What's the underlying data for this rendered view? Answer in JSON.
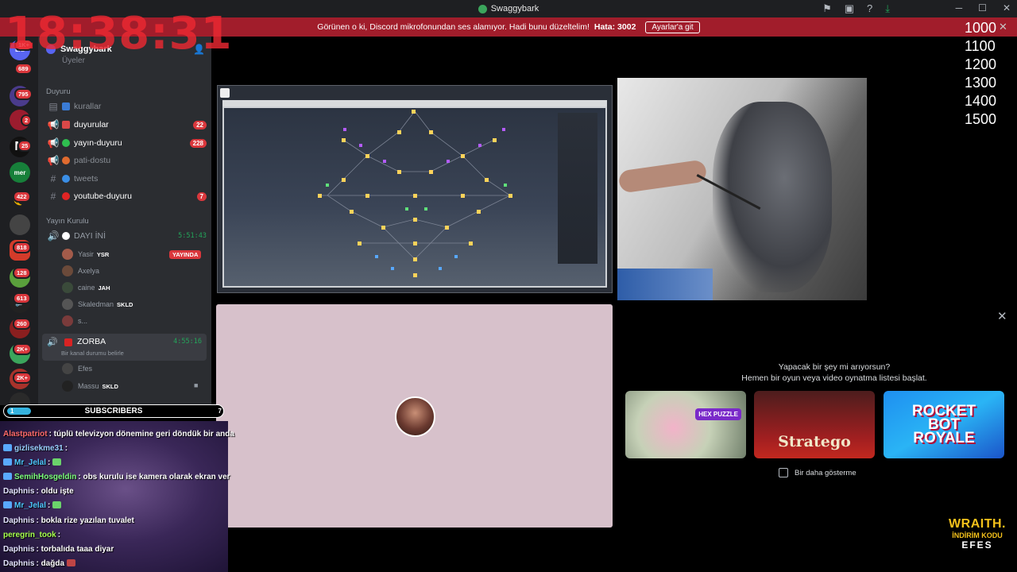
{
  "window": {
    "title": "Swaggybark"
  },
  "notice": {
    "message": "Görünen o ki, Discord mikrofonundan ses alamıyor. Hadi bunu düzeltelim!",
    "error_label": "Hata: 3002",
    "button": "Ayarlar'a git"
  },
  "overlay_clock": "18:38:31",
  "overlay_numbers": [
    "1000",
    "1100",
    "1200",
    "1300",
    "1400",
    "1500"
  ],
  "rail": {
    "top_label": "ENİ",
    "badges": [
      "1K+",
      "689",
      "795",
      "2",
      "25",
      "422",
      "818",
      "128",
      "613",
      "260",
      "2K+",
      "2K+"
    ]
  },
  "server": {
    "name": "Swaggybark",
    "sub": "Üyeler"
  },
  "categories": {
    "announcements": "Duyuru",
    "broadcast": "Yayın Kurulu"
  },
  "channels": [
    {
      "name": "kurallar",
      "count": "",
      "color": "#3a7bd5",
      "muted": true
    },
    {
      "name": "duyurular",
      "count": "22",
      "color": "#d94848",
      "muted": false
    },
    {
      "name": "yayın-duyuru",
      "count": "228",
      "color": "#2fbf4f",
      "muted": false
    },
    {
      "name": "pati-dostu",
      "count": "",
      "color": "#e06b2f",
      "muted": true
    },
    {
      "name": "tweets",
      "count": "",
      "color": "#3a8ee6",
      "muted": true
    },
    {
      "name": "youtube-duyuru",
      "count": "7",
      "color": "#e02424",
      "muted": false
    }
  ],
  "voice1": {
    "name": "DAYI İNİ",
    "time": "5:51:43",
    "users": [
      {
        "name": "Yasir",
        "tag": "YSR",
        "live": "YAYINDA"
      },
      {
        "name": "Axelya",
        "tag": "",
        "live": ""
      },
      {
        "name": "caine",
        "tag": "JAH",
        "live": ""
      },
      {
        "name": "Skaledman",
        "tag": "SKLD",
        "live": ""
      },
      {
        "name": "s...",
        "tag": "",
        "live": ""
      }
    ]
  },
  "voice2": {
    "name": "ZORBA",
    "time": "4:55:16",
    "status": "Bir kanal durumu belirle",
    "users": [
      {
        "name": "Efes",
        "tag": ""
      },
      {
        "name": "Massu",
        "tag": "SKLD"
      }
    ]
  },
  "subs_bar": {
    "label": "SUBSCRIBERS",
    "left": "1",
    "right": "7"
  },
  "chat": [
    {
      "name": "Alastpatriot",
      "color": "#ff6b6b",
      "text": "túplü televizyon dönemine geri döndük bir anda"
    },
    {
      "name": "gizlisekme31",
      "color": "#9ad0ff",
      "text": ""
    },
    {
      "name": "Mr_Jelal",
      "color": "#4ec8ff",
      "text": ""
    },
    {
      "name": "SemihHosgeldin",
      "color": "#7cff7c",
      "text": "obs kurulu ise kamera olarak ekran ver"
    },
    {
      "name": "Daphnis",
      "color": "#e3e3ff",
      "text": "oldu işte"
    },
    {
      "name": "Mr_Jelal",
      "color": "#4ec8ff",
      "text": ""
    },
    {
      "name": "Daphnis",
      "color": "#e3e3ff",
      "text": "bokla rize yazılan tuvalet"
    },
    {
      "name": "peregrin_took",
      "color": "#a6ff4d",
      "text": ""
    },
    {
      "name": "Daphnis",
      "color": "#e3e3ff",
      "text": "torbalıda taaa diyar"
    },
    {
      "name": "Daphnis",
      "color": "#e3e3ff",
      "text": "dağda"
    }
  ],
  "activity": {
    "title": "Yapacak bir şey mi arıyorsun?",
    "subtitle": "Hemen bir oyun veya video oynatma listesi başlat.",
    "games": [
      {
        "name": "HEX PUZZLE"
      },
      {
        "name": "Stratego"
      },
      {
        "name": "ROCKET BOT ROYALE"
      }
    ],
    "dont_show": "Bir daha gösterme"
  },
  "sponsor": {
    "brand": "WRAITH.",
    "line": "İNDİRİM KODU",
    "code": "EFES"
  }
}
